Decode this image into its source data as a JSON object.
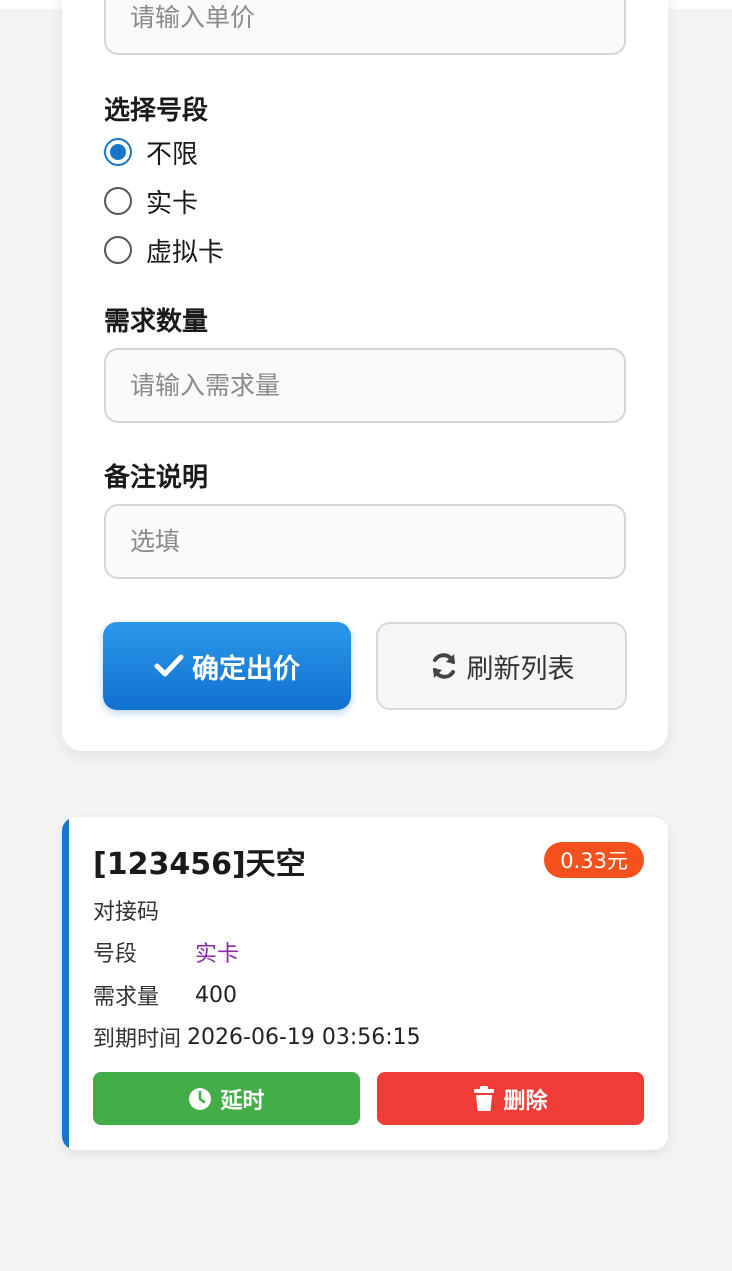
{
  "form": {
    "price_placeholder": "请输入单价",
    "segment_label": "选择号段",
    "segment_options": [
      "不限",
      "实卡",
      "虚拟卡"
    ],
    "segment_selected": "不限",
    "quantity_label": "需求数量",
    "quantity_placeholder": "请输入需求量",
    "remark_label": "备注说明",
    "remark_placeholder": "选填",
    "confirm_label": "确定出价",
    "refresh_label": "刷新列表"
  },
  "order": {
    "title": "[123456]天空",
    "price": "0.33元",
    "fields": [
      {
        "key": "对接码",
        "value": ""
      },
      {
        "key": "号段",
        "value": "实卡"
      },
      {
        "key": "需求量",
        "value": "400"
      },
      {
        "key": "到期时间",
        "value": "2026-06-19 03:56:15"
      }
    ],
    "extend_label": "延时",
    "delete_label": "删除"
  },
  "colors": {
    "primary": "#1677c8",
    "accent_bar": "#1676c9",
    "price_badge": "#f5511e",
    "extend": "#43ad48",
    "delete": "#f03c36",
    "segment_value": "#8a2aa5"
  },
  "icons": {
    "confirm": "check-icon",
    "refresh": "refresh-icon",
    "extend": "clock-icon",
    "delete": "trash-icon"
  }
}
